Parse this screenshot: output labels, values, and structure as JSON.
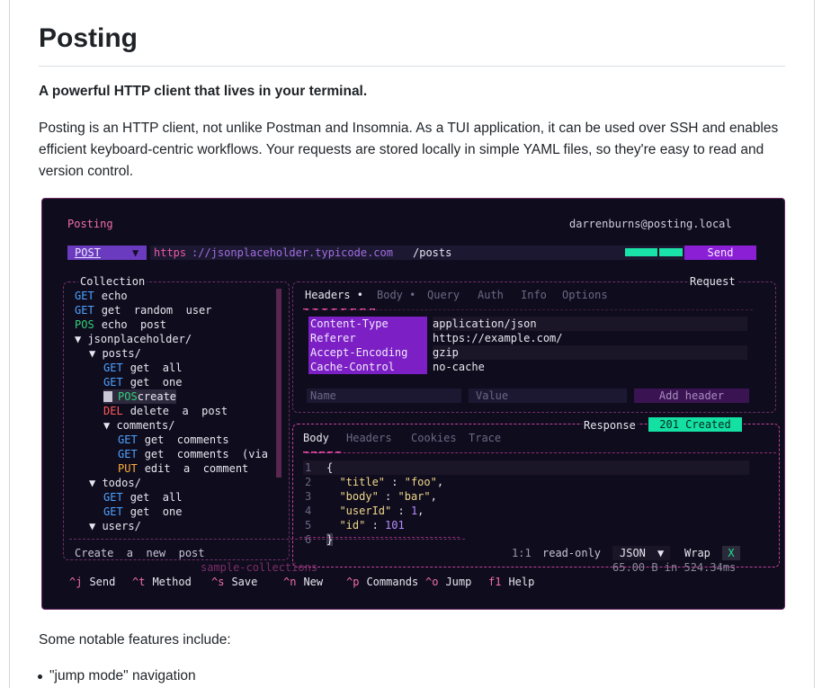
{
  "doc": {
    "title": "Posting",
    "lead": "A powerful HTTP client that lives in your terminal.",
    "paragraph": "Posting is an HTTP client, not unlike Postman and Insomnia. As a TUI application, it can be used over SSH and enables efficient keyboard-centric workflows. Your requests are stored locally in simple YAML files, so they're easy to read and version control.",
    "features_intro": "Some notable features include:",
    "bullets": [
      "\"jump mode\" navigation"
    ]
  },
  "app": {
    "title": "Posting",
    "account": "darrenburns@posting.local",
    "method": "POST",
    "url_scheme": "https",
    "url_host": "://jsonplaceholder.typicode.com",
    "url_path": "/posts",
    "send_label": "Send"
  },
  "collection": {
    "title": "Collection",
    "items": [
      {
        "method": "GET",
        "label": "echo"
      },
      {
        "method": "GET",
        "label": "get  random  user"
      },
      {
        "method": "POS",
        "label": "echo  post"
      },
      {
        "folder": "▼ jsonplaceholder/"
      },
      {
        "folder": "▼ posts/"
      },
      {
        "method": "GET",
        "label": "get  all"
      },
      {
        "method": "GET",
        "label": "get  one"
      },
      {
        "method": "POS",
        "label": "create",
        "selected": true
      },
      {
        "method": "DEL",
        "label": "delete  a  post"
      },
      {
        "folder": "▼ comments/"
      },
      {
        "method": "GET",
        "label": "get  comments"
      },
      {
        "method": "GET",
        "label": "get  comments  (via"
      },
      {
        "method": "PUT",
        "label": "edit  a  comment"
      },
      {
        "folder": "▼ todos/"
      },
      {
        "method": "GET",
        "label": "get  all"
      },
      {
        "method": "GET",
        "label": "get  one"
      },
      {
        "folder": "▼ users/"
      }
    ],
    "footer": "Create  a  new  post",
    "subtitle": "sample-collections"
  },
  "request": {
    "title": "Request",
    "tabs": [
      "Headers •",
      "Body •",
      "Query",
      "Auth",
      "Info",
      "Options"
    ],
    "headers": [
      {
        "name": "Content-Type",
        "value": "application/json"
      },
      {
        "name": "Referer",
        "value": "https://example.com/"
      },
      {
        "name": "Accept-Encoding",
        "value": "gzip"
      },
      {
        "name": "Cache-Control",
        "value": "no-cache"
      }
    ],
    "name_placeholder": "Name",
    "value_placeholder": "Value",
    "add_header_label": "Add  header"
  },
  "response": {
    "title": "Response",
    "status": "201  Created",
    "tabs": [
      "Body",
      "Headers",
      "Cookies",
      "Trace"
    ],
    "lines": [
      "{",
      "  \"title\" : \"foo\",",
      "  \"body\" : \"bar\",",
      "  \"userId\" : 1,",
      "  \"id\" : 101",
      "}"
    ],
    "cursor": "1:1",
    "mode": "read-only",
    "format": "JSON",
    "wrap_label": "Wrap",
    "wrap_value": "X",
    "stats": "65.00 B in 524.34ms"
  },
  "footer_keys": [
    {
      "key": "^j",
      "label": "Send"
    },
    {
      "key": "^t",
      "label": "Method"
    },
    {
      "key": "^s",
      "label": "Save"
    },
    {
      "key": "^n",
      "label": "New"
    },
    {
      "key": "^p",
      "label": "Commands"
    },
    {
      "key": "^o",
      "label": "Jump"
    },
    {
      "key": "f1",
      "label": "Help"
    }
  ]
}
